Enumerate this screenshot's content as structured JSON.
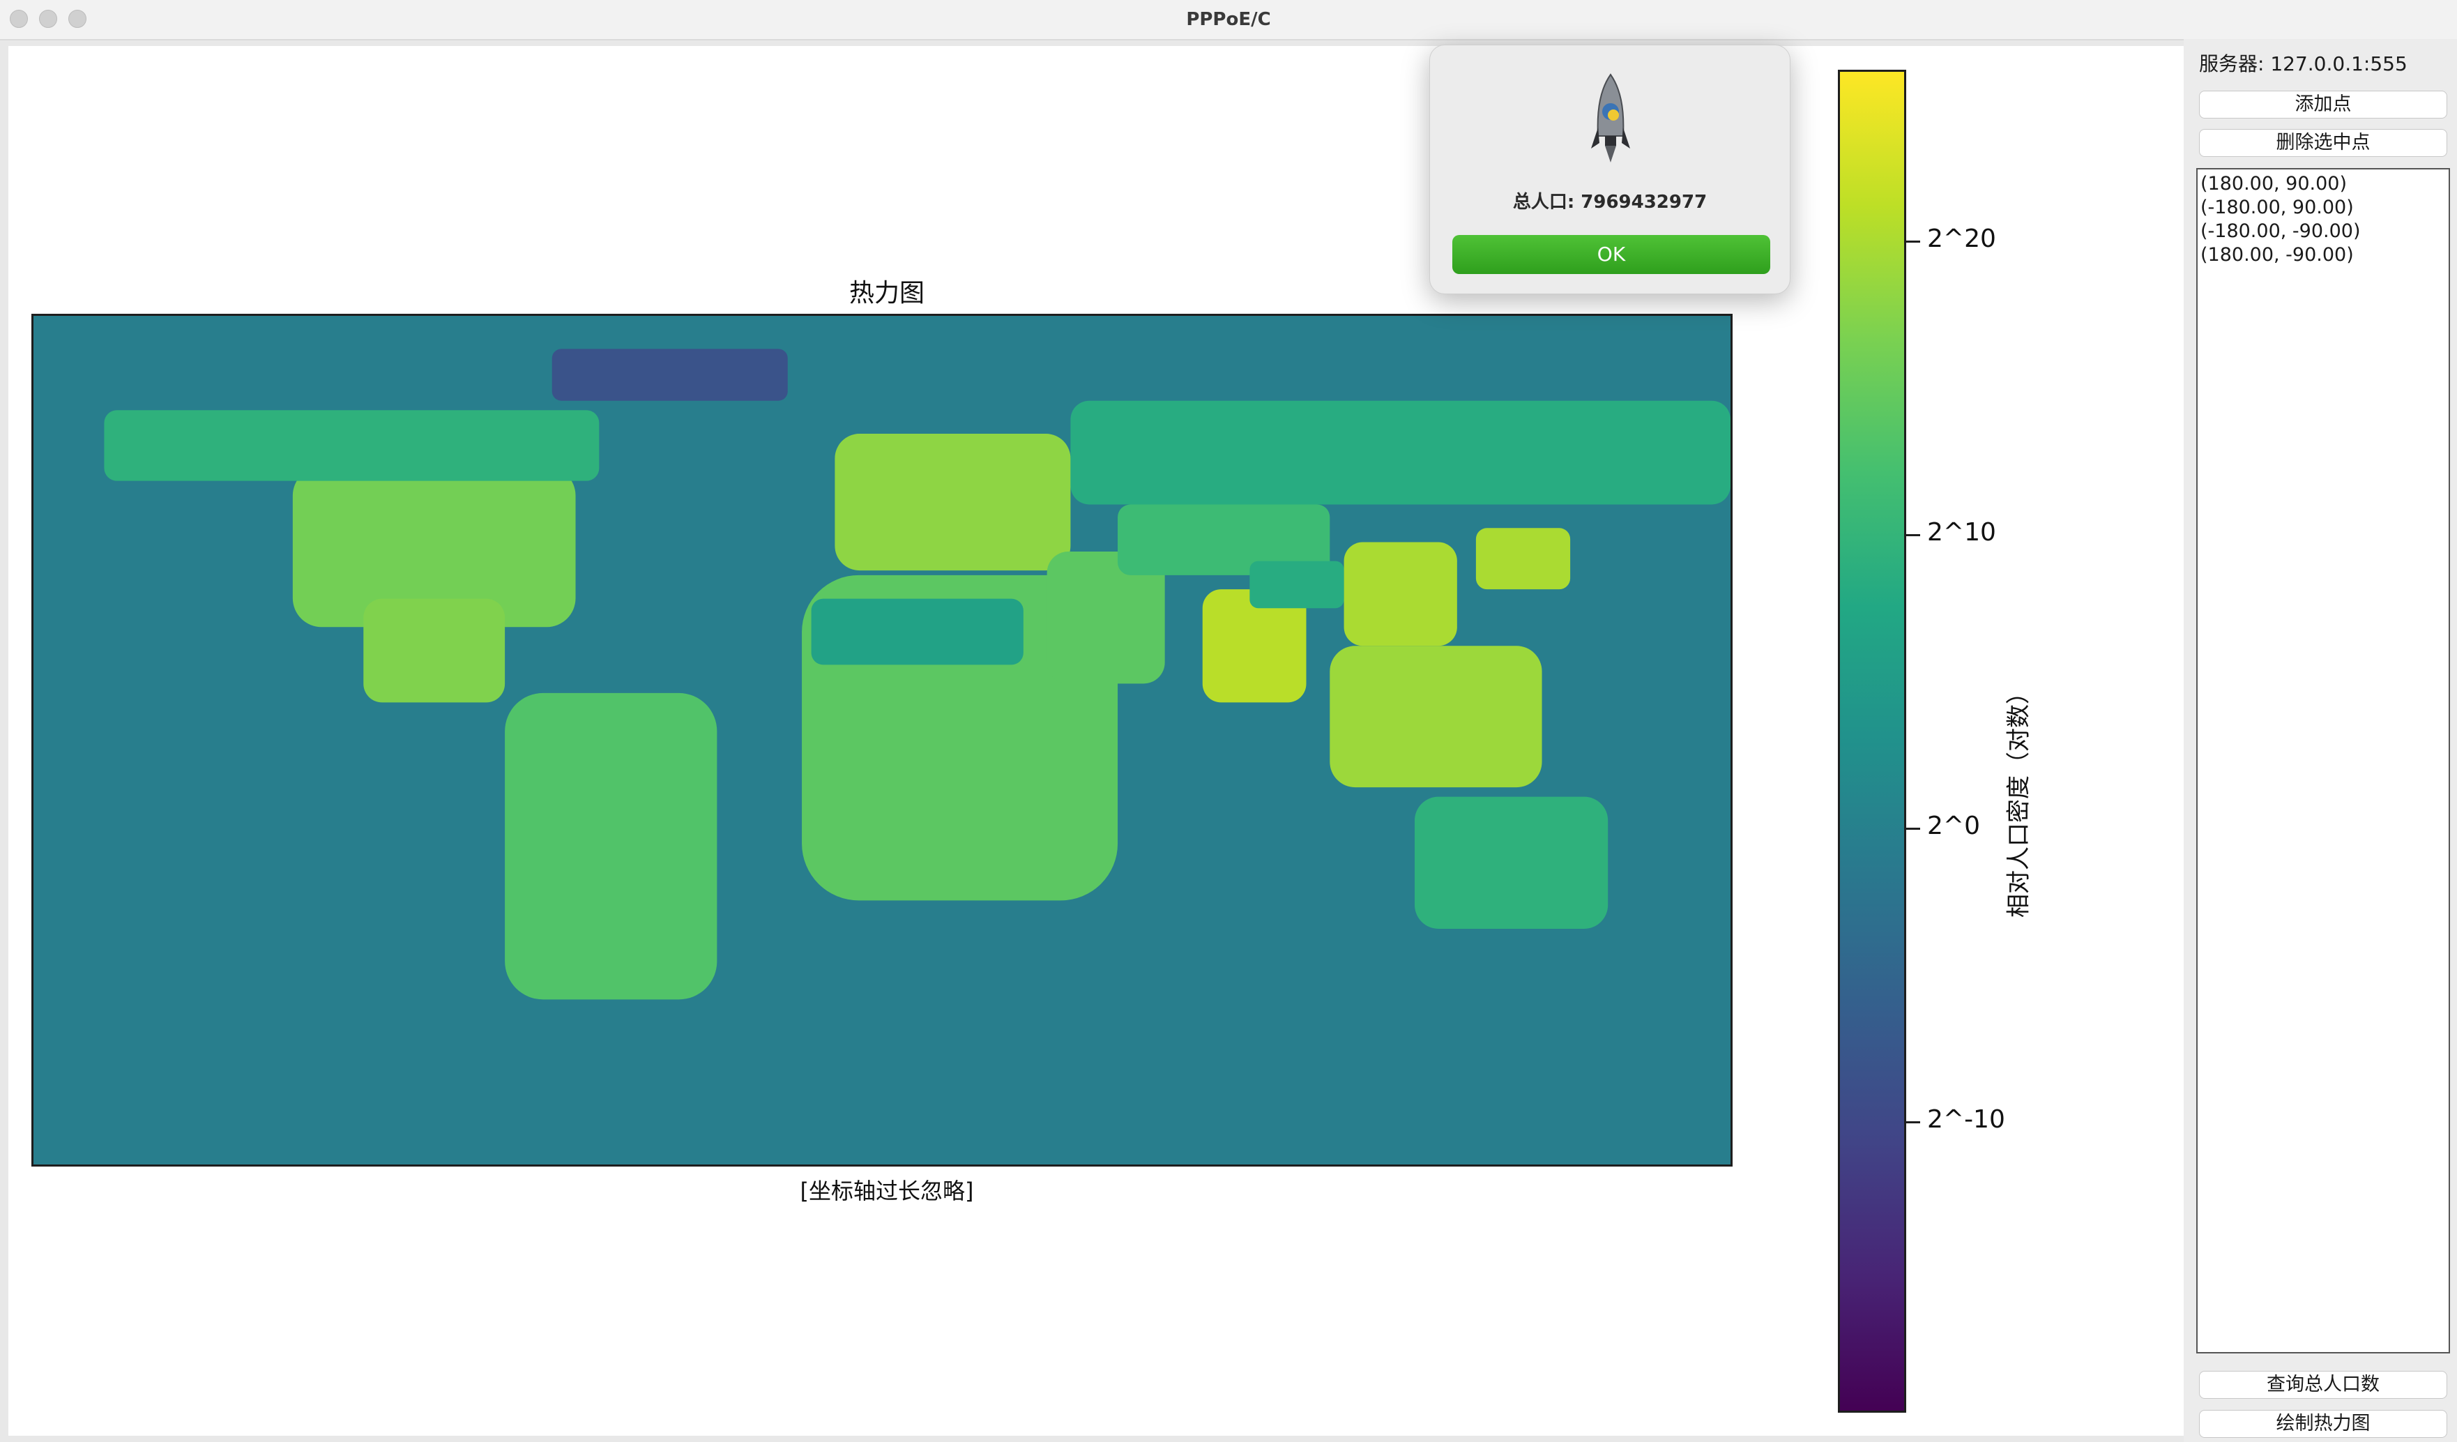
{
  "window": {
    "title": "PPPoE/C"
  },
  "chart": {
    "title": "热力图",
    "axis_note": "[坐标轴过长忽略]",
    "colorbar_label": "相对人口密度（对数）",
    "colorbar_ticks": [
      "2^20",
      "2^10",
      "2^0",
      "2^-10"
    ]
  },
  "chart_data": {
    "type": "heatmap",
    "title": "热力图",
    "x_extent": [
      -180,
      180
    ],
    "y_extent": [
      -90,
      90
    ],
    "colorscale": "viridis",
    "color_range_log2": [
      -20,
      27
    ],
    "background_value_log2": 0,
    "colorbar": {
      "label": "相对人口密度（对数）",
      "ticks": [
        {
          "label": "2^20",
          "value": 20
        },
        {
          "label": "2^10",
          "value": 10
        },
        {
          "label": "2^0",
          "value": 0
        },
        {
          "label": "2^-10",
          "value": -10
        }
      ]
    },
    "regions": [
      {
        "name": "north-america",
        "lon": [
          -125,
          -65
        ],
        "lat": [
          24,
          58
        ],
        "value": 17
      },
      {
        "name": "alaska-canada",
        "lon": [
          -165,
          -60
        ],
        "lat": [
          55,
          70
        ],
        "value": 10
      },
      {
        "name": "mexico-central",
        "lon": [
          -110,
          -80
        ],
        "lat": [
          8,
          30
        ],
        "value": 18
      },
      {
        "name": "south-america",
        "lon": [
          -80,
          -35
        ],
        "lat": [
          -55,
          10
        ],
        "value": 14
      },
      {
        "name": "europe",
        "lon": [
          -10,
          40
        ],
        "lat": [
          36,
          65
        ],
        "value": 19
      },
      {
        "name": "russia",
        "lon": [
          40,
          180
        ],
        "lat": [
          50,
          72
        ],
        "value": 9
      },
      {
        "name": "africa",
        "lon": [
          -17,
          50
        ],
        "lat": [
          -34,
          35
        ],
        "value": 15
      },
      {
        "name": "sahara",
        "lon": [
          -15,
          30
        ],
        "lat": [
          16,
          30
        ],
        "value": 7
      },
      {
        "name": "middle-east",
        "lon": [
          35,
          60
        ],
        "lat": [
          12,
          40
        ],
        "value": 15
      },
      {
        "name": "central-asia",
        "lon": [
          50,
          95
        ],
        "lat": [
          35,
          50
        ],
        "value": 12
      },
      {
        "name": "india",
        "lon": [
          68,
          90
        ],
        "lat": [
          8,
          32
        ],
        "value": 22
      },
      {
        "name": "china",
        "lon": [
          98,
          122
        ],
        "lat": [
          20,
          42
        ],
        "value": 21
      },
      {
        "name": "tibet",
        "lon": [
          78,
          98
        ],
        "lat": [
          28,
          38
        ],
        "value": 9
      },
      {
        "name": "southeast-asia",
        "lon": [
          95,
          140
        ],
        "lat": [
          -10,
          20
        ],
        "value": 20
      },
      {
        "name": "japan-korea",
        "lon": [
          126,
          146
        ],
        "lat": [
          32,
          45
        ],
        "value": 21
      },
      {
        "name": "australia",
        "lon": [
          113,
          154
        ],
        "lat": [
          -40,
          -12
        ],
        "value": 10
      },
      {
        "name": "greenland",
        "lon": [
          -70,
          -20
        ],
        "lat": [
          72,
          83
        ],
        "value": -8
      }
    ]
  },
  "dialog": {
    "message": "总人口: 7969432977",
    "ok_label": "OK",
    "icon": "python-rocket-icon"
  },
  "panel": {
    "server_label": "服务器: 127.0.0.1:555",
    "add_point_label": "添加点",
    "delete_point_label": "删除选中点",
    "points": [
      "(180.00, 90.00)",
      "(-180.00, 90.00)",
      "(-180.00, -90.00)",
      "(180.00, -90.00)"
    ],
    "query_label": "查询总人口数",
    "draw_label": "绘制热力图"
  }
}
